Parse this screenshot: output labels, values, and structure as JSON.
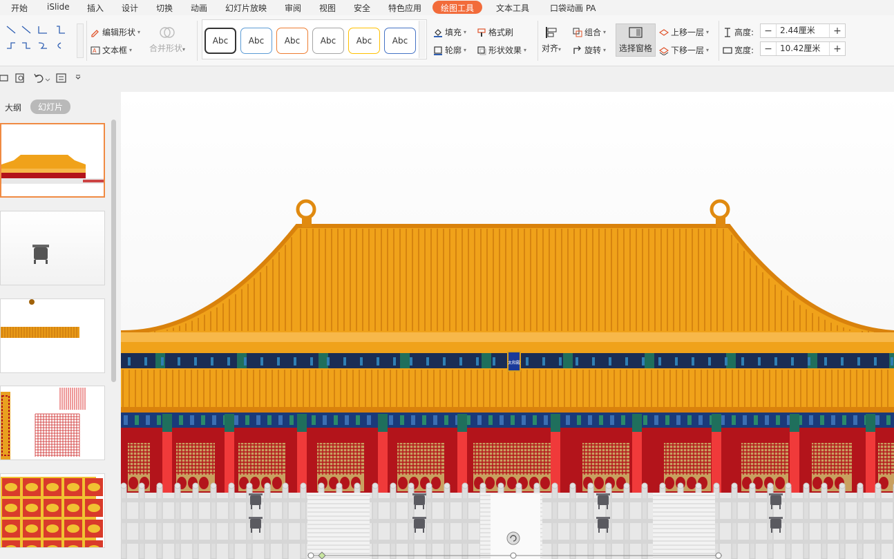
{
  "menu": {
    "items": [
      "开始",
      "iSlide",
      "插入",
      "设计",
      "切换",
      "动画",
      "幻灯片放映",
      "审阅",
      "视图",
      "安全",
      "特色应用",
      "绘图工具",
      "文本工具",
      "口袋动画 PA"
    ],
    "active_index": 11
  },
  "ribbon": {
    "edit_shape": "编辑形状",
    "text_box": "文本框",
    "merge_shapes": "合并形状",
    "style_label": "Abc",
    "style_colors": [
      "#333333",
      "#5b9bd5",
      "#ed7d31",
      "#a5a5a5",
      "#ffc000",
      "#4472c4"
    ],
    "fill": "填充",
    "format_brush": "格式刷",
    "outline": "轮廓",
    "shape_effects": "形状效果",
    "align": "对齐",
    "group": "组合",
    "rotate": "旋转",
    "selection_pane": "选择窗格",
    "bring_forward": "上移一层",
    "send_backward": "下移一层",
    "height_label": "高度:",
    "height_value": "2.44厘米",
    "width_label": "宽度:",
    "width_value": "10.42厘米",
    "minus": "−",
    "plus": "+"
  },
  "panel": {
    "tab_outline": "大纲",
    "tab_slides": "幻灯片",
    "active_tab": "幻灯片"
  },
  "plaque_text": "太和殿",
  "colors": {
    "accent": "#f26b3a",
    "roof": "#f0a21a",
    "roof_dark": "#c4700a",
    "wall_red": "#b3141b",
    "pillar": "#f03a3a",
    "teal": "#1f6f5c",
    "navy": "#1a3a7a",
    "marble": "#e8e8e8"
  }
}
